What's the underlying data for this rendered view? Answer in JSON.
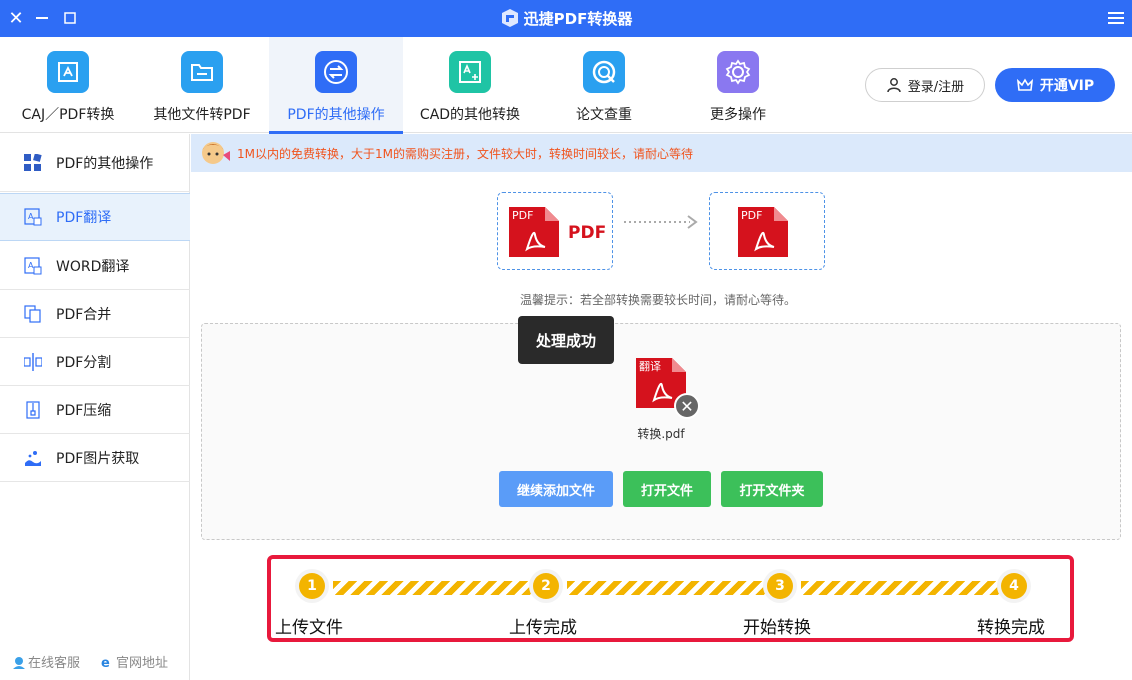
{
  "window": {
    "title": "迅捷PDF转换器"
  },
  "toolbar": {
    "items": [
      {
        "label": "CAJ／PDF转换",
        "icon": "caj-pdf-icon",
        "color": "#2aa0f0"
      },
      {
        "label": "其他文件转PDF",
        "icon": "folder-icon",
        "color": "#2aa0f0"
      },
      {
        "label": "PDF的其他操作",
        "icon": "swap-icon",
        "color": "#2f6df6"
      },
      {
        "label": "CAD的其他转换",
        "icon": "cad-icon",
        "color": "#1fc4a5"
      },
      {
        "label": "论文查重",
        "icon": "search-circle-icon",
        "color": "#2aa0f0"
      },
      {
        "label": "更多操作",
        "icon": "gear-icon",
        "color": "#8a78f0"
      }
    ],
    "active_index": 2,
    "login_label": "登录/注册",
    "vip_label": "开通VIP"
  },
  "sidebar": {
    "items": [
      {
        "label": "PDF的其他操作",
        "icon": "grid-icon"
      },
      {
        "label": "PDF翻译",
        "icon": "translate-icon"
      },
      {
        "label": "WORD翻译",
        "icon": "translate-icon"
      },
      {
        "label": "PDF合并",
        "icon": "merge-icon"
      },
      {
        "label": "PDF分割",
        "icon": "split-icon"
      },
      {
        "label": "PDF压缩",
        "icon": "compress-icon"
      },
      {
        "label": "PDF图片获取",
        "icon": "image-extract-icon"
      }
    ],
    "active_index": 1,
    "footer": {
      "service": "在线客服",
      "website": "官网地址"
    }
  },
  "notice": {
    "text": "1M以内的免费转换，大于1M的需购买注册，文件较大时，转换时间较长，请耐心等待"
  },
  "conversion": {
    "source_badge": "PDF",
    "source_label": "PDF",
    "target_badge": "PDF",
    "hint": "温馨提示：若全部转换需要较长时间，请耐心等待。"
  },
  "dropzone": {
    "tooltip": "处理成功",
    "file_badge": "翻译",
    "file_name": "转换.pdf",
    "buttons": {
      "add": "继续添加文件",
      "open_file": "打开文件",
      "open_folder": "打开文件夹"
    }
  },
  "steps": [
    {
      "num": "1",
      "label": "上传文件"
    },
    {
      "num": "2",
      "label": "上传完成"
    },
    {
      "num": "3",
      "label": "开始转换"
    },
    {
      "num": "4",
      "label": "转换完成"
    }
  ],
  "colors": {
    "brand": "#2f6df6",
    "green": "#3cc05a",
    "notice_text": "#f0541e",
    "step_yellow": "#f3b400",
    "step_border": "#e8193c"
  }
}
